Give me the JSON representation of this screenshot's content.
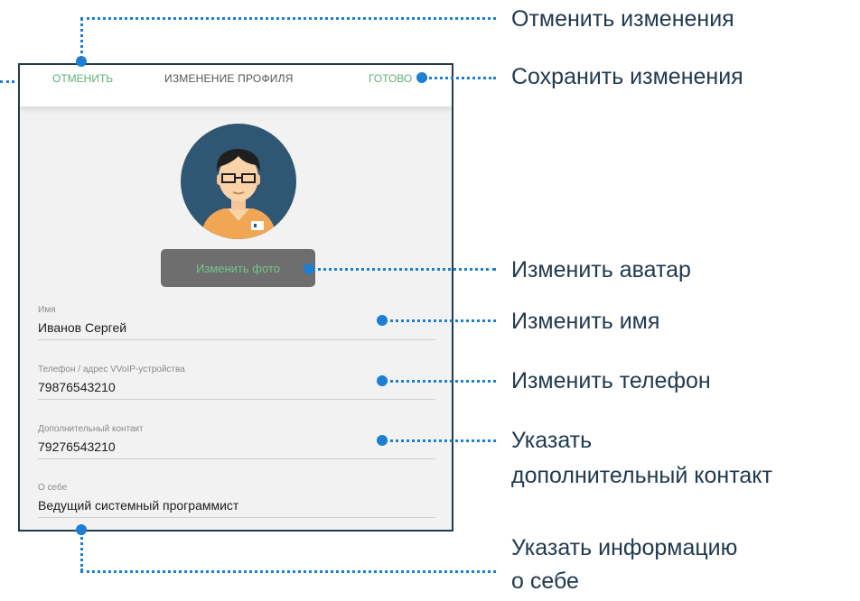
{
  "header": {
    "cancel_label": "ОТМЕНИТЬ",
    "title": "ИЗМЕНЕНИЕ ПРОФИЛЯ",
    "done_label": "ГОТОВО"
  },
  "avatar": {
    "icon": "user-avatar-icon"
  },
  "change_photo_label": "Изменить фото",
  "fields": [
    {
      "label": "Имя",
      "value": "Иванов Сергей"
    },
    {
      "label": "Телефон / адрес VVoIP-устройства",
      "value": "79876543210"
    },
    {
      "label": "Дополнительный контакт",
      "value": "79276543210"
    },
    {
      "label": "О себе",
      "value": "Ведущий системный программист"
    }
  ],
  "annotations": {
    "cancel": "Отменить изменения",
    "save": "Сохранить изменения",
    "avatar": "Изменить аватар",
    "name": "Изменить имя",
    "phone": "Изменить телефон",
    "contact_line1": "Указать",
    "contact_line2": "дополнительный контакт",
    "about_line1": "Указать информацию",
    "about_line2": "о себе"
  },
  "colors": {
    "accent_green": "#5fae7a",
    "frame": "#213a4f",
    "callout_blue": "#1c7fd3",
    "button_gray": "#6e6e6e"
  }
}
